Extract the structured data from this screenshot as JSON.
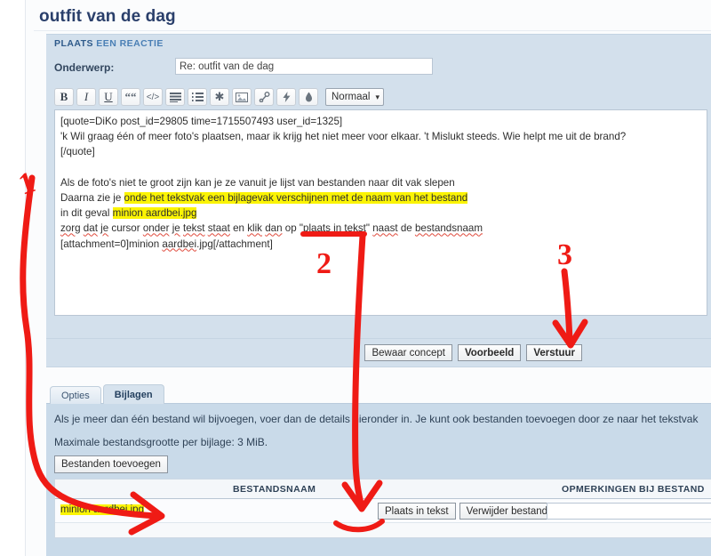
{
  "topic": {
    "title": "outfit van de dag"
  },
  "reply_panel": {
    "header_word1": "PLAATS",
    "header_word2": "EEN REACTIE",
    "subject_label": "Onderwerp:",
    "subject_value": "Re: outfit van de dag",
    "subject_placeholder": ""
  },
  "toolbar": {
    "buttons": [
      {
        "name": "bold-button",
        "label": "B",
        "icon": "bold-icon"
      },
      {
        "name": "italic-button",
        "label": "I",
        "icon": "italic-icon"
      },
      {
        "name": "underline-button",
        "label": "U",
        "icon": "underline-icon"
      },
      {
        "name": "quote-button",
        "label": "““",
        "icon": "quote-icon"
      },
      {
        "name": "code-button",
        "label": "</>",
        "icon": "code-icon"
      },
      {
        "name": "unordered-list-button",
        "label": "",
        "icon": "list-unordered-icon"
      },
      {
        "name": "ordered-list-button",
        "label": "",
        "icon": "list-ordered-icon"
      },
      {
        "name": "special-char-button",
        "label": "✱",
        "icon": "asterisk-icon"
      },
      {
        "name": "insert-image-button",
        "label": "",
        "icon": "image-icon"
      },
      {
        "name": "insert-link-button",
        "label": "",
        "icon": "link-icon"
      },
      {
        "name": "flash-button",
        "label": "",
        "icon": "lightning-icon"
      },
      {
        "name": "font-color-button",
        "label": "",
        "icon": "droplet-icon"
      }
    ],
    "font_size_selected": "Normaal",
    "font_size_options": [
      "Normaal"
    ],
    "caret": "⌄"
  },
  "message": {
    "lines": [
      {
        "id": "l1",
        "segments": [
          {
            "t": "[quote=DiKo post_id=29805 time=1715507493 user_id=1325]"
          }
        ]
      },
      {
        "id": "l2",
        "segments": [
          {
            "t": "'k Wil graag één of meer foto's plaatsen, maar ik krijg het niet meer voor elkaar. 't Mislukt steeds. Wie helpt me uit de brand?"
          }
        ]
      },
      {
        "id": "l3",
        "segments": [
          {
            "t": "[/quote]"
          }
        ]
      },
      {
        "id": "l4",
        "segments": [
          {
            "t": ""
          }
        ]
      },
      {
        "id": "l5",
        "segments": [
          {
            "t": "Als de foto's niet te groot zijn kan je ze vanuit je lijst van bestanden naar dit vak slepen"
          }
        ]
      },
      {
        "id": "l6",
        "segments": [
          {
            "t": "Daarna zie je "
          },
          {
            "t": "onde het tekstvak een bijlagevak verschijnen met de naam van het bestand",
            "hl": true
          }
        ]
      },
      {
        "id": "l7",
        "segments": [
          {
            "t": "in dit geval "
          },
          {
            "t": "minion aardbei.jpg",
            "hl": true
          }
        ]
      },
      {
        "id": "l8",
        "segments": [
          {
            "t": "zorg",
            "sp": true
          },
          {
            "t": " "
          },
          {
            "t": "dat",
            "sp": true
          },
          {
            "t": " "
          },
          {
            "t": "je",
            "sp": true
          },
          {
            "t": " cursor "
          },
          {
            "t": "onder",
            "sp": true
          },
          {
            "t": " "
          },
          {
            "t": "je",
            "sp": true
          },
          {
            "t": " "
          },
          {
            "t": "tekst",
            "sp": true
          },
          {
            "t": " "
          },
          {
            "t": "staat",
            "sp": true
          },
          {
            "t": " en "
          },
          {
            "t": "klik",
            "sp": true
          },
          {
            "t": " "
          },
          {
            "t": "dan",
            "sp": true
          },
          {
            "t": " op \""
          },
          {
            "t": "plaats",
            "sp": true
          },
          {
            "t": " in "
          },
          {
            "t": "tekst",
            "sp": true
          },
          {
            "t": "\" "
          },
          {
            "t": "naast",
            "sp": true
          },
          {
            "t": " de "
          },
          {
            "t": "bestandsnaam",
            "sp": true
          }
        ]
      },
      {
        "id": "l9",
        "segments": [
          {
            "t": "[attachment=0]minion "
          },
          {
            "t": "aardbei",
            "sp": true
          },
          {
            "t": ".jpg[/attachment]"
          }
        ]
      }
    ]
  },
  "actions": {
    "save_draft_label": "Bewaar concept",
    "preview_label": "Voorbeeld",
    "submit_label": "Verstuur"
  },
  "tabs": [
    {
      "label": "Opties",
      "active": false
    },
    {
      "label": "Bijlagen",
      "active": true
    }
  ],
  "attachments": {
    "info_line": "Als je meer dan één bestand wil bijvoegen, voer dan de details hieronder in. Je kunt ook bestanden toevoegen door ze naar het tekstvak",
    "max_size_line": "Maximale bestandsgrootte per bijlage: 3 MiB.",
    "add_files_label": "Bestanden toevoegen",
    "columns": {
      "filename": "BESTANDSNAAM",
      "comment": "OPMERKINGEN BIJ BESTAND"
    },
    "rows": [
      {
        "filename": "minion aardbei.jpg",
        "place_in_text_label": "Plaats in tekst",
        "delete_label": "Verwijder bestand",
        "comment_value": "",
        "comment_placeholder": ""
      }
    ]
  },
  "annotations": {
    "color": "#ef1b15",
    "items": [
      {
        "label": "1",
        "target": "attachment-filename"
      },
      {
        "label": "2",
        "target": "place-in-text-button"
      },
      {
        "label": "3",
        "target": "submit-button"
      }
    ]
  },
  "colors": {
    "panel_bg": "#d3e0ec",
    "attach_bg": "#c9dae9",
    "title_color": "#2a3f6b",
    "highlight": "#fbf404",
    "annotation_red": "#ef1b15"
  }
}
